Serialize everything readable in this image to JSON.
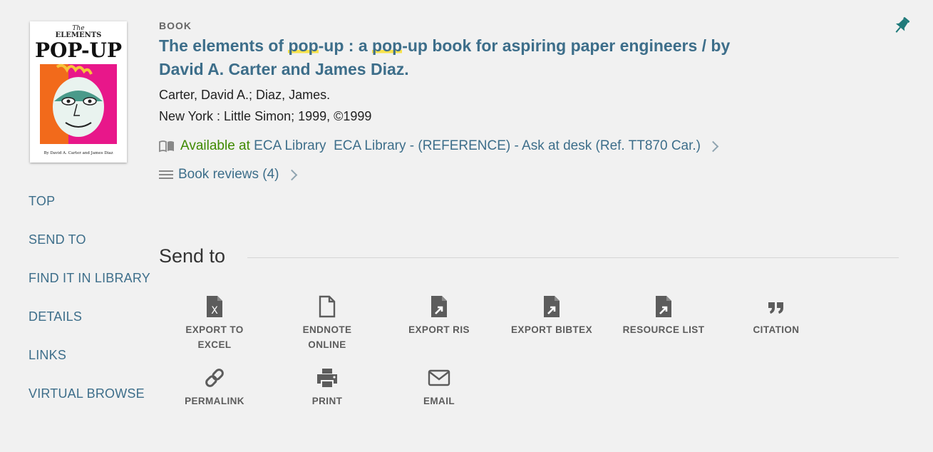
{
  "cover": {
    "alt": "Book cover",
    "text_line1": "The",
    "text_line2": "ELEMENTS",
    "text_line3": "POP-UP",
    "byline": "By David A. Carter and James Diaz"
  },
  "side_nav": {
    "items": [
      {
        "label": "TOP"
      },
      {
        "label": "SEND TO"
      },
      {
        "label": "FIND IT IN LIBRARY"
      },
      {
        "label": "DETAILS"
      },
      {
        "label": "LINKS"
      },
      {
        "label": "VIRTUAL BROWSE"
      }
    ]
  },
  "record": {
    "type": "BOOK",
    "title_part1": "The elements of ",
    "title_hl1": "pop",
    "title_part2": "-up : a ",
    "title_hl2": "pop",
    "title_part3": "-up book for aspiring paper engineers / by David A. Carter and James Diaz.",
    "authors": "Carter, David A.; Diaz, James.",
    "publication": "New York : Little Simon; 1999, ©1999",
    "availability_status": "Available at",
    "availability_location": "ECA Library  ECA Library - (REFERENCE) - Ask at desk (Ref. TT870 Car.)",
    "reviews": "Book reviews (4)"
  },
  "send_to": {
    "heading": "Send to",
    "actions": [
      {
        "label_l1": "EXPORT TO",
        "label_l2": "EXCEL",
        "icon": "excel-file-icon"
      },
      {
        "label_l1": "ENDNOTE",
        "label_l2": "ONLINE",
        "icon": "file-icon"
      },
      {
        "label_l1": "EXPORT RIS",
        "label_l2": "",
        "icon": "file-export-icon"
      },
      {
        "label_l1": "EXPORT BIBTEX",
        "label_l2": "",
        "icon": "file-export-icon"
      },
      {
        "label_l1": "RESOURCE LIST",
        "label_l2": "",
        "icon": "file-export-icon"
      },
      {
        "label_l1": "CITATION",
        "label_l2": "",
        "icon": "quote-icon"
      },
      {
        "label_l1": "PERMALINK",
        "label_l2": "",
        "icon": "link-icon"
      },
      {
        "label_l1": "PRINT",
        "label_l2": "",
        "icon": "printer-icon"
      },
      {
        "label_l1": "EMAIL",
        "label_l2": "",
        "icon": "envelope-icon"
      }
    ]
  },
  "colors": {
    "link": "#3d6e8a",
    "available": "#3f8a00",
    "highlight": "#f7e24b",
    "pin": "#1f7a7a"
  }
}
